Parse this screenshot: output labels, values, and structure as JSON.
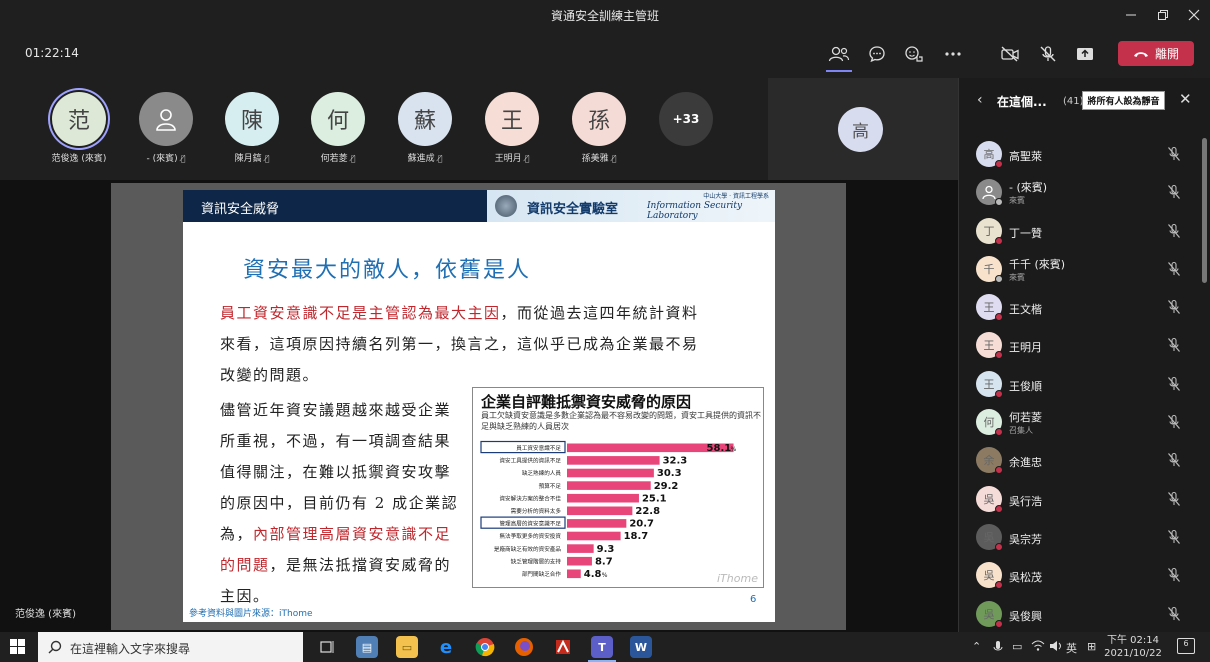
{
  "window": {
    "title": "資通安全訓練主管班"
  },
  "call": {
    "timer": "01:22:14",
    "leave_label": "離開"
  },
  "gallery": {
    "participants": [
      {
        "initial": "范",
        "name": "范俊逸 (來賓)",
        "bg": "#dde9d6",
        "speaking": true
      },
      {
        "initial": "",
        "name": "- (來賓)",
        "bg": "#8a8a8a",
        "speaking": false
      },
      {
        "initial": "陳",
        "name": "陳月鎬",
        "bg": "#d6eef0",
        "speaking": false
      },
      {
        "initial": "何",
        "name": "何若菱",
        "bg": "#dceee0",
        "speaking": false
      },
      {
        "initial": "蘇",
        "name": "蘇進成",
        "bg": "#d8e3ef",
        "speaking": false
      },
      {
        "initial": "王",
        "name": "王明月",
        "bg": "#f6ddd6",
        "speaking": false
      },
      {
        "initial": "孫",
        "name": "孫美雅",
        "bg": "#f4dbd6",
        "speaking": false
      }
    ],
    "overflow": "+33",
    "side_initial": "高"
  },
  "slide": {
    "header": "資訊安全威脅",
    "lab_zh": "資訊安全實驗室",
    "lab_en": "Information Security Laboratory",
    "univ": "中山大學 · 資訊工程學系",
    "title": "資安最大的敵人，依舊是人",
    "p1_red": "員工資安意識不足是主管認為最大主因",
    "p1_a": "，而從過去這四年統計資料",
    "p1_b": "來看，這項原因持續名列第一，換言之，這似乎已成為企業最不易",
    "p1_c": "改變的問題。",
    "p2_lines": [
      "儘管近年資安議題越來越受企業",
      "所重視，不過，有一項調查結果",
      "值得關注，在難以抵禦資安攻擊",
      "的原因中，目前仍有 2 成企業認"
    ],
    "p2_e_a": "為，",
    "p2_e_red": "內部管理高層資安意識不足",
    "p2_f_red": "的問題",
    "p2_f_b": "，是無法抵擋資安威脅的",
    "p2_g": "主因。",
    "reference": "參考資料與圖片來源：iThome",
    "page_number": "6"
  },
  "chart_data": {
    "type": "bar",
    "title": "企業自評難抵禦資安威脅的原因",
    "subtitle": "員工欠缺資安意識是多數企業認為最不容易改變的問題，資安工具提供的資訊不足與缺乏熟練的人員居次",
    "categories": [
      "員工資安意識不足",
      "資安工具提供的資訊不足",
      "缺乏熟練的人員",
      "預算不足",
      "資安解決方案的整合不佳",
      "需要分析的資料太多",
      "管理高層的資安意識不足",
      "無法爭取更多的資安投資",
      "是廠商缺乏有效的資安產品",
      "缺乏管理階層的支持",
      "部門間缺乏合作"
    ],
    "values": [
      58.1,
      32.3,
      30.3,
      29.2,
      25.1,
      22.8,
      20.7,
      18.7,
      9.3,
      8.7,
      4.8
    ],
    "value_labels": [
      "58.1",
      "32.3",
      "30.3",
      "29.2",
      "25.1",
      "22.8",
      "20.7",
      "18.7",
      "9.3",
      "8.7",
      "4.8"
    ],
    "unit": "%",
    "highlighted": [
      0,
      6
    ],
    "watermark": "iThome",
    "bar_color": "#e8457a"
  },
  "stage": {
    "presenter_name": "范俊逸 (來賓)"
  },
  "sidebar": {
    "title": "在這個...",
    "count": "(41)",
    "mute_all_label": "將所有人設為靜音",
    "participants": [
      {
        "initial": "高",
        "name": "高聖萊",
        "sub": "",
        "bg": "#d8dcef",
        "dot": "red"
      },
      {
        "initial": "",
        "name": "- (來賓)",
        "sub": "來賓",
        "bg": "#8a8a8a",
        "dot": "gray"
      },
      {
        "initial": "丁",
        "name": "丁一贊",
        "sub": "",
        "bg": "#e9e2cf",
        "dot": "red"
      },
      {
        "initial": "千",
        "name": "千千 (來賓)",
        "sub": "來賓",
        "bg": "#f8e2cc",
        "dot": "gray"
      },
      {
        "initial": "王",
        "name": "王文楷",
        "sub": "",
        "bg": "#dfdcf1",
        "dot": "red"
      },
      {
        "initial": "王",
        "name": "王明月",
        "sub": "",
        "bg": "#f6ddd6",
        "dot": "red"
      },
      {
        "initial": "王",
        "name": "王俊順",
        "sub": "",
        "bg": "#d6e4ef",
        "dot": "red"
      },
      {
        "initial": "何",
        "name": "何若菱",
        "sub": "召集人",
        "bg": "#dceee0",
        "dot": "red"
      },
      {
        "initial": "余",
        "name": "余進忠",
        "sub": "",
        "bg": "#8c7b62",
        "dot": "red"
      },
      {
        "initial": "吳",
        "name": "吳行浩",
        "sub": "",
        "bg": "#f6dcd8",
        "dot": "red"
      },
      {
        "initial": "吳",
        "name": "吳宗芳",
        "sub": "",
        "bg": "#5c5c5c",
        "dot": "red"
      },
      {
        "initial": "吳",
        "name": "吳松茂",
        "sub": "",
        "bg": "#f8e2cc",
        "dot": "red"
      },
      {
        "initial": "吳",
        "name": "吳俊興",
        "sub": "",
        "bg": "#6f9a5a",
        "dot": "red"
      }
    ]
  },
  "taskbar": {
    "search_placeholder": "在這裡輸入文字來搜尋",
    "ime": "英",
    "time": "下午 02:14",
    "date": "2021/10/22",
    "notifications": "6"
  }
}
